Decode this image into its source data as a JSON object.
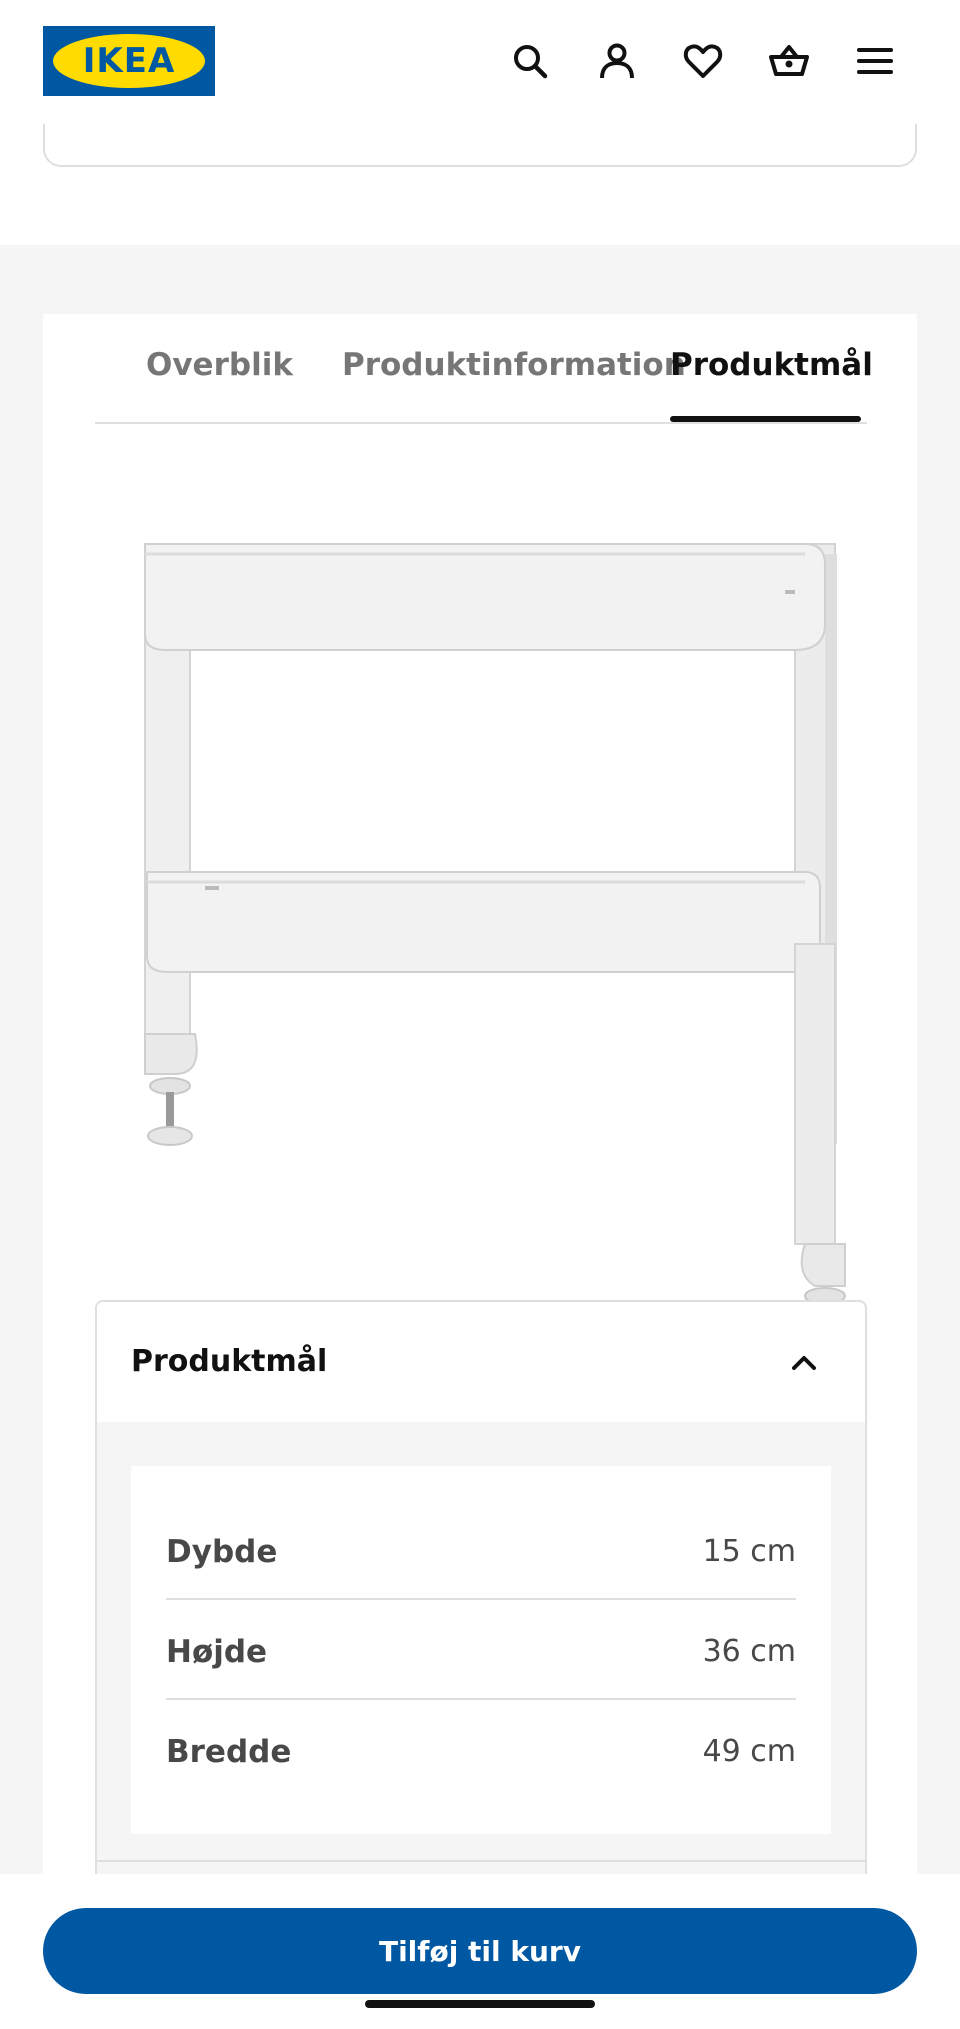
{
  "header": {
    "logo_text": "IKEA",
    "icons": [
      "search-icon",
      "account-icon",
      "heart-icon",
      "cart-icon",
      "menu-icon"
    ]
  },
  "tabs": [
    {
      "label": "Overblik",
      "active": false
    },
    {
      "label": "Produktinformation",
      "active": false
    },
    {
      "label": "Produktmål",
      "active": true
    }
  ],
  "accordion": {
    "title": "Produktmål",
    "expanded": true,
    "rows": [
      {
        "label": "Dybde",
        "value": "15 cm"
      },
      {
        "label": "Højde",
        "value": "36 cm"
      },
      {
        "label": "Bredde",
        "value": "49 cm"
      }
    ]
  },
  "cta": {
    "label": "Tilføj til kurv"
  },
  "colors": {
    "brand_blue": "#0058a3",
    "brand_yellow": "#ffdb00",
    "divider": "#dfdfdf",
    "page_bg": "#f5f5f5"
  }
}
